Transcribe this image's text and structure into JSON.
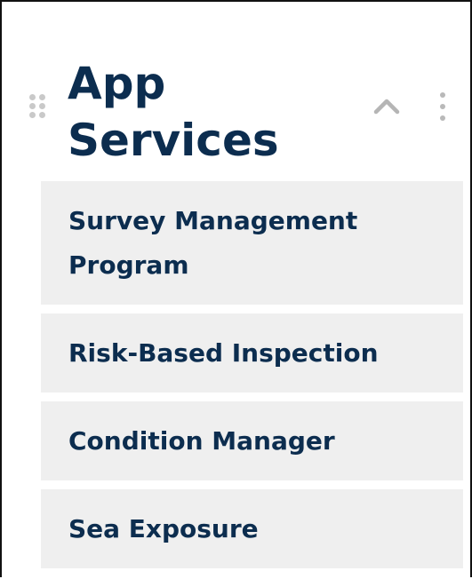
{
  "panel": {
    "title_line1": "App",
    "title_line2": "Services",
    "icons": {
      "drag": "drag-handle-icon",
      "collapse": "chevron-up-icon",
      "more": "more-vertical-icon"
    },
    "colors": {
      "title": "#0c2d4f",
      "item_text": "#0c2d4f",
      "item_background": "#efefef",
      "icon_gray": "#b9b9b9"
    }
  },
  "services": {
    "items": [
      {
        "label": "Survey Management Program"
      },
      {
        "label": "Risk-Based Inspection"
      },
      {
        "label": "Condition Manager"
      },
      {
        "label": "Sea Exposure"
      }
    ]
  }
}
